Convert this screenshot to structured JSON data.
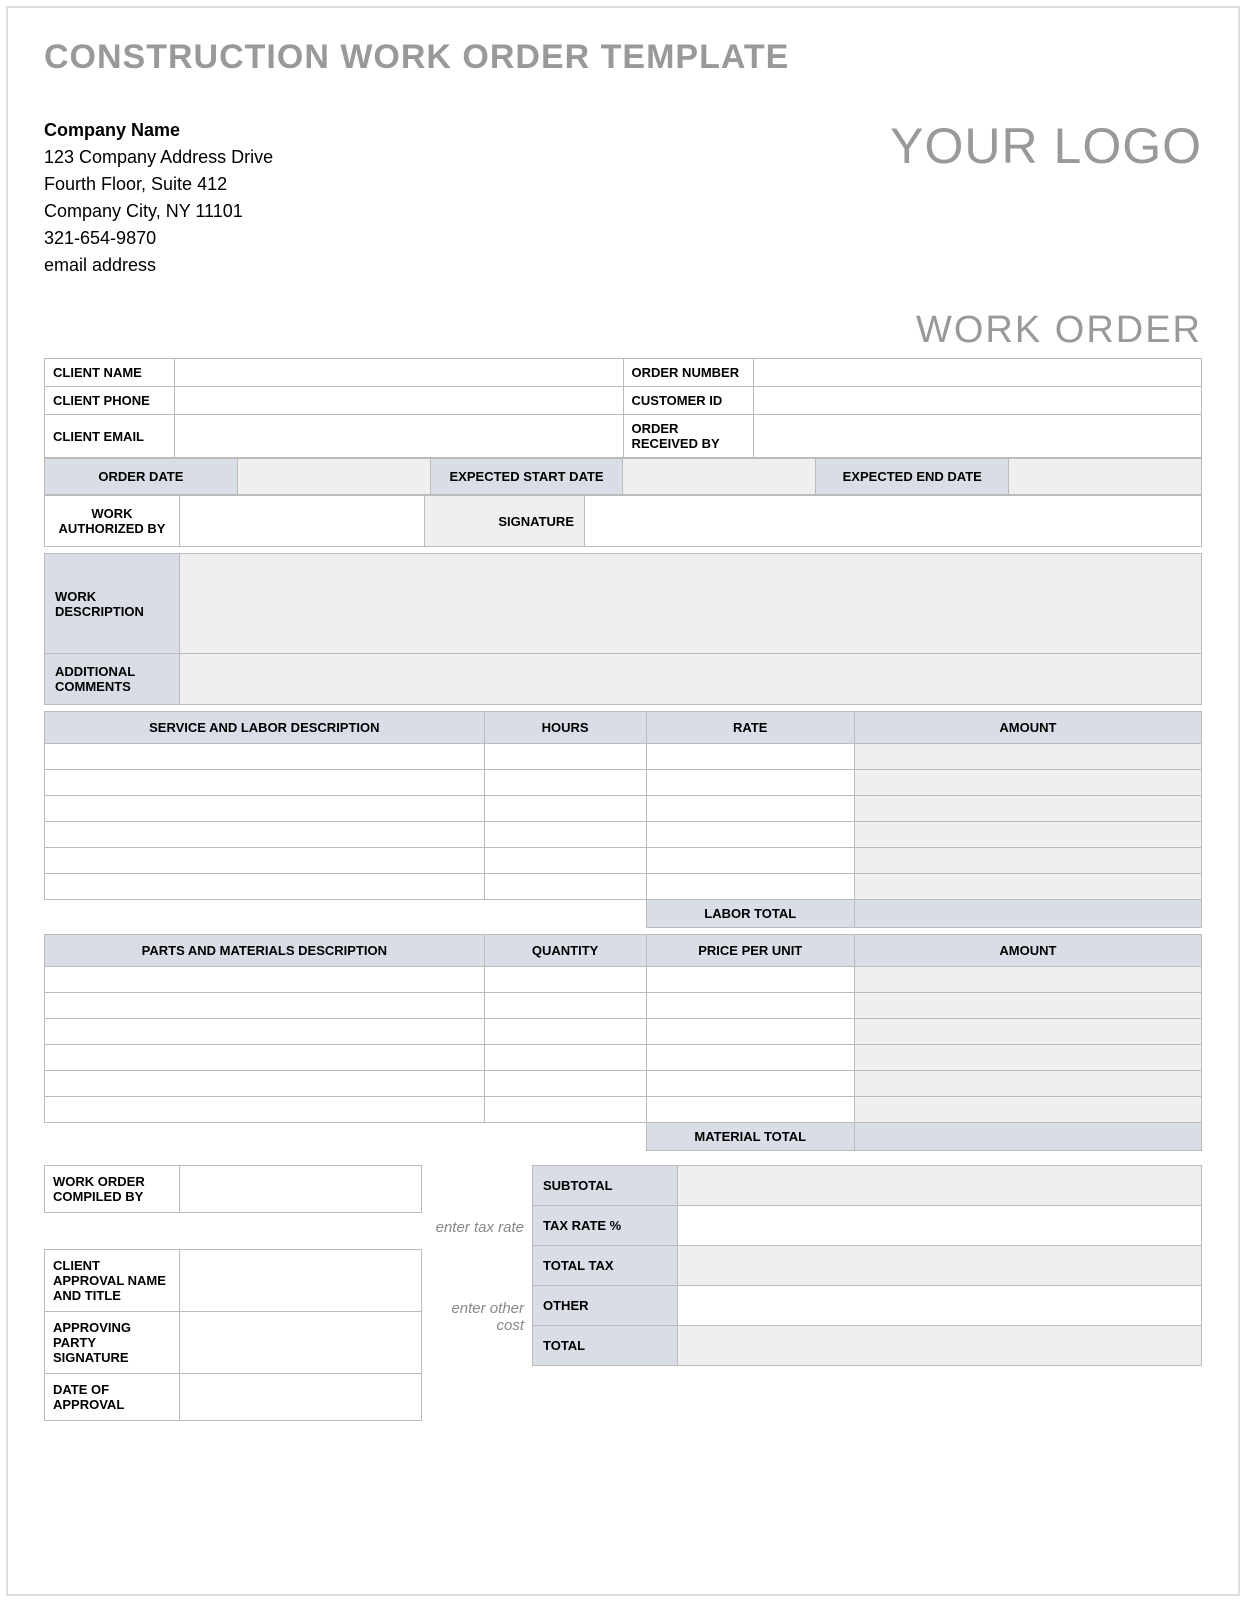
{
  "title": "CONSTRUCTION WORK ORDER TEMPLATE",
  "company": {
    "name": "Company Name",
    "addr1": "123 Company Address Drive",
    "addr2": "Fourth Floor, Suite 412",
    "addr3": "Company City, NY  11101",
    "phone": "321-654-9870",
    "email": "email address"
  },
  "logo_text": "YOUR LOGO",
  "work_order_label": "WORK ORDER",
  "info_labels": {
    "client_name": "CLIENT NAME",
    "client_phone": "CLIENT PHONE",
    "client_email": "CLIENT EMAIL",
    "order_number": "ORDER NUMBER",
    "customer_id": "CUSTOMER ID",
    "order_received_by": "ORDER RECEIVED BY",
    "order_date": "ORDER DATE",
    "expected_start": "EXPECTED START DATE",
    "expected_end": "EXPECTED END DATE",
    "work_auth_by": "WORK AUTHORIZED BY",
    "signature": "SIGNATURE",
    "work_desc": "WORK DESCRIPTION",
    "add_comments": "ADDITIONAL COMMENTS"
  },
  "labor": {
    "header": {
      "desc": "SERVICE AND LABOR DESCRIPTION",
      "hours": "HOURS",
      "rate": "RATE",
      "amount": "AMOUNT"
    },
    "total_label": "LABOR TOTAL"
  },
  "materials": {
    "header": {
      "desc": "PARTS AND MATERIALS DESCRIPTION",
      "qty": "QUANTITY",
      "price": "PRICE PER UNIT",
      "amount": "AMOUNT"
    },
    "total_label": "MATERIAL TOTAL"
  },
  "bottom_left": {
    "compiled_by": "WORK ORDER COMPILED BY",
    "client_approval": "CLIENT APPROVAL NAME AND TITLE",
    "approving_sig": "APPROVING PARTY SIGNATURE",
    "date_approval": "DATE OF APPROVAL"
  },
  "hints": {
    "tax": "enter tax rate",
    "other": "enter other cost"
  },
  "totals": {
    "subtotal": "SUBTOTAL",
    "taxrate": "TAX RATE %",
    "totaltax": "TOTAL TAX",
    "other": "OTHER",
    "total": "TOTAL"
  }
}
